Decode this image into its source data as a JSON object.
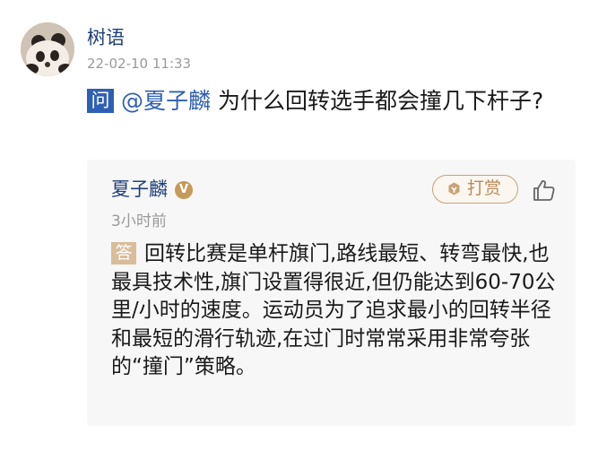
{
  "post": {
    "author": "树语",
    "timestamp": "22-02-10 11:33",
    "question_badge": "问",
    "mention": "@夏子麟",
    "question_text": " 为什么回转选手都会撞几下杆子?"
  },
  "answer": {
    "author": "夏子麟",
    "verified_badge": "V",
    "reward_label": "打赏",
    "time_ago": "3小时前",
    "answer_badge": "答",
    "text": "回转比赛是单杆旗门,路线最短、转弯最快,也最具技术性,旗门设置得很近,但仍能达到60-70公里/小时的速度。运动员为了追求最小的回转半径和最短的滑行轨迹,在过门时常常采用非常夸张的“撞门”策略。"
  },
  "icons": {
    "avatar": "panda-avatar",
    "reward": "reward-icon",
    "like": "thumbs-up-icon"
  },
  "colors": {
    "link_blue": "#1f3f7a",
    "question_badge": "#2f5fb4",
    "answer_badge": "#d9bc9a",
    "reward_gold": "#c8a376",
    "meta_gray": "#9a9a9a"
  }
}
